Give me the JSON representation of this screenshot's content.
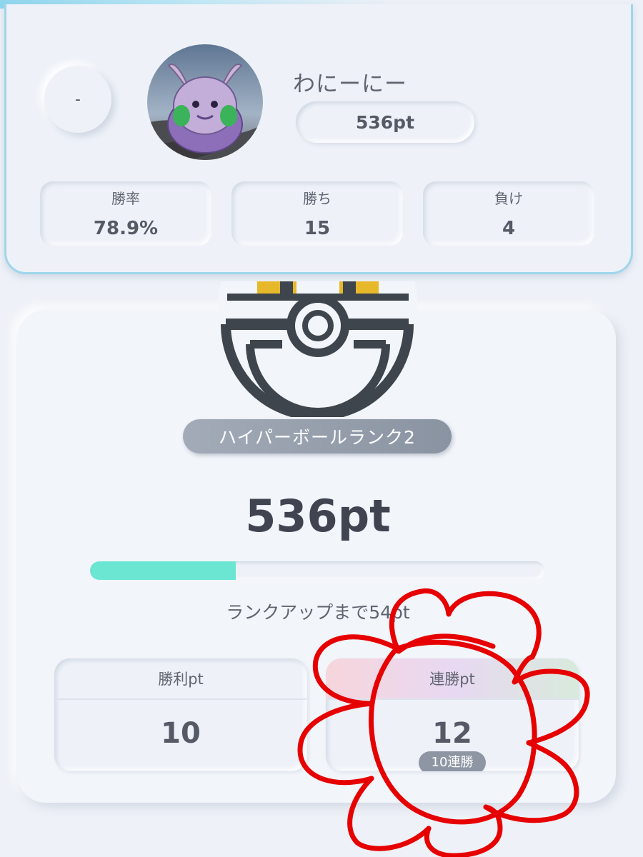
{
  "profile": {
    "rank_position": "-",
    "player_name": "わにーにー",
    "points": "536pt",
    "stats": [
      {
        "label": "勝率",
        "value": "78.9%"
      },
      {
        "label": "勝ち",
        "value": "15"
      },
      {
        "label": "負け",
        "value": "4"
      }
    ]
  },
  "rank": {
    "badge": "ハイパーボールランク2",
    "points": "536pt",
    "progress_fraction": 0.32,
    "rankup_text": "ランクアップまで54pt",
    "win_pt": {
      "label": "勝利pt",
      "value": "10"
    },
    "streak_pt": {
      "label": "連勝pt",
      "value": "12",
      "streak": "10連勝"
    }
  },
  "colors": {
    "progress_fill": "#6ae6d3",
    "card_border": "#9fd6ea",
    "annotation": "#e60000"
  },
  "icons": {
    "avatar": "goodra-avatar",
    "ball": "hyper-ball-icon"
  }
}
